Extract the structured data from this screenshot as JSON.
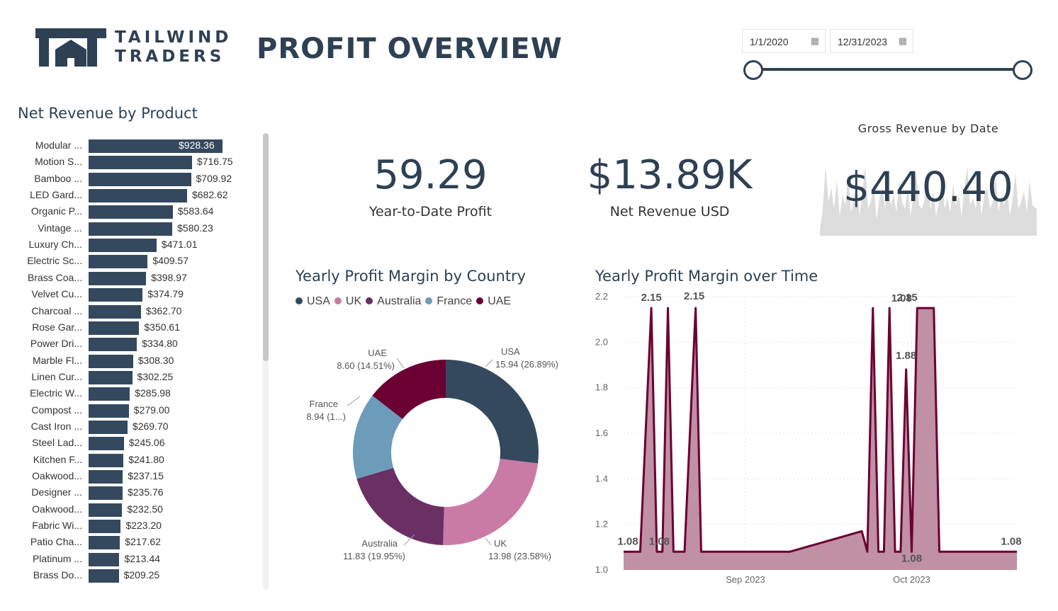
{
  "header": {
    "logo_line1": "TAILWIND",
    "logo_line2": "TRADERS",
    "title": "PROFIT OVERVIEW"
  },
  "date_range": {
    "start": "1/1/2020",
    "end": "12/31/2023",
    "calendar_icon": "calendar-icon"
  },
  "net_revenue_by_product": {
    "title": "Net Revenue by Product",
    "items": [
      {
        "label": "Modular ...",
        "value": "$928.36",
        "amount": 928.36
      },
      {
        "label": "Motion S...",
        "value": "$716.75",
        "amount": 716.75
      },
      {
        "label": "Bamboo ...",
        "value": "$709.92",
        "amount": 709.92
      },
      {
        "label": "LED Gard...",
        "value": "$682.62",
        "amount": 682.62
      },
      {
        "label": "Organic P...",
        "value": "$583.64",
        "amount": 583.64
      },
      {
        "label": "Vintage ...",
        "value": "$580.23",
        "amount": 580.23
      },
      {
        "label": "Luxury Ch...",
        "value": "$471.01",
        "amount": 471.01
      },
      {
        "label": "Electric Sc...",
        "value": "$409.57",
        "amount": 409.57
      },
      {
        "label": "Brass Coa...",
        "value": "$398.97",
        "amount": 398.97
      },
      {
        "label": "Velvet Cu...",
        "value": "$374.79",
        "amount": 374.79
      },
      {
        "label": "Charcoal ...",
        "value": "$362.70",
        "amount": 362.7
      },
      {
        "label": "Rose Gar...",
        "value": "$350.61",
        "amount": 350.61
      },
      {
        "label": "Power Dri...",
        "value": "$334.80",
        "amount": 334.8
      },
      {
        "label": "Marble Fl...",
        "value": "$308.30",
        "amount": 308.3
      },
      {
        "label": "Linen Cur...",
        "value": "$302.25",
        "amount": 302.25
      },
      {
        "label": "Electric W...",
        "value": "$285.98",
        "amount": 285.98
      },
      {
        "label": "Compost ...",
        "value": "$279.00",
        "amount": 279.0
      },
      {
        "label": "Cast Iron ...",
        "value": "$269.70",
        "amount": 269.7
      },
      {
        "label": "Steel Lad...",
        "value": "$245.06",
        "amount": 245.06
      },
      {
        "label": "Kitchen F...",
        "value": "$241.80",
        "amount": 241.8
      },
      {
        "label": "Oakwood...",
        "value": "$237.15",
        "amount": 237.15
      },
      {
        "label": "Designer ...",
        "value": "$235.76",
        "amount": 235.76
      },
      {
        "label": "Oakwood...",
        "value": "$232.50",
        "amount": 232.5
      },
      {
        "label": "Fabric Wi...",
        "value": "$223.20",
        "amount": 223.2
      },
      {
        "label": "Patio Cha...",
        "value": "$217.62",
        "amount": 217.62
      },
      {
        "label": "Platinum ...",
        "value": "$213.44",
        "amount": 213.44
      },
      {
        "label": "Brass Do...",
        "value": "$209.25",
        "amount": 209.25
      }
    ]
  },
  "kpis": {
    "ytd_profit": {
      "value": "59.29",
      "label": "Year-to-Date Profit"
    },
    "net_revenue": {
      "value": "$13.89K",
      "label": "Net Revenue USD"
    },
    "gross_revenue": {
      "title": "Gross Revenue by Date",
      "value": "$440.40"
    }
  },
  "profit_margin_by_country": {
    "title": "Yearly Profit Margin by Country",
    "legend": [
      {
        "name": "USA",
        "color": "#34495e"
      },
      {
        "name": "UK",
        "color": "#c97ba5"
      },
      {
        "name": "Australia",
        "color": "#6a2f63"
      },
      {
        "name": "France",
        "color": "#6d9bba"
      },
      {
        "name": "UAE",
        "color": "#6b0032"
      }
    ],
    "slices": [
      {
        "name": "USA",
        "value": 15.94,
        "pct": "26.89%",
        "label_name": "USA",
        "label_value": "15.94 (26.89%)"
      },
      {
        "name": "UK",
        "value": 13.98,
        "pct": "23.58%",
        "label_name": "UK",
        "label_value": "13.98 (23.58%)"
      },
      {
        "name": "Australia",
        "value": 11.83,
        "pct": "19.95%",
        "label_name": "Australia",
        "label_value": "11.83 (19.95%)"
      },
      {
        "name": "France",
        "value": 8.94,
        "pct": "15.07%",
        "label_name": "France",
        "label_value": "8.94 (1...)"
      },
      {
        "name": "UAE",
        "value": 8.6,
        "pct": "14.51%",
        "label_name": "UAE",
        "label_value": "8.60 (14.51%)"
      }
    ]
  },
  "profit_margin_over_time": {
    "title": "Yearly Profit Margin over Time",
    "color": "#6b0032",
    "fill": "#c090a5"
  },
  "chart_data": [
    {
      "type": "bar",
      "title": "Net Revenue by Product",
      "orientation": "horizontal",
      "categories": [
        "Modular ...",
        "Motion S...",
        "Bamboo ...",
        "LED Gard...",
        "Organic P...",
        "Vintage ...",
        "Luxury Ch...",
        "Electric Sc...",
        "Brass Coa...",
        "Velvet Cu...",
        "Charcoal ...",
        "Rose Gar...",
        "Power Dri...",
        "Marble Fl...",
        "Linen Cur...",
        "Electric W...",
        "Compost ...",
        "Cast Iron ...",
        "Steel Lad...",
        "Kitchen F...",
        "Oakwood...",
        "Designer ...",
        "Oakwood...",
        "Fabric Wi...",
        "Patio Cha...",
        "Platinum ...",
        "Brass Do..."
      ],
      "values": [
        928.36,
        716.75,
        709.92,
        682.62,
        583.64,
        580.23,
        471.01,
        409.57,
        398.97,
        374.79,
        362.7,
        350.61,
        334.8,
        308.3,
        302.25,
        285.98,
        279.0,
        269.7,
        245.06,
        241.8,
        237.15,
        235.76,
        232.5,
        223.2,
        217.62,
        213.44,
        209.25
      ]
    },
    {
      "type": "pie",
      "title": "Yearly Profit Margin by Country",
      "categories": [
        "USA",
        "UK",
        "Australia",
        "France",
        "UAE"
      ],
      "values": [
        15.94,
        13.98,
        11.83,
        8.94,
        8.6
      ],
      "donut": true
    },
    {
      "type": "area",
      "title": "Yearly Profit Margin over Time",
      "ylim": [
        1.0,
        2.2
      ],
      "yticks": [
        "2.2",
        "2.0",
        "1.8",
        "1.6",
        "1.4",
        "1.2",
        "1.0"
      ],
      "xticks": [
        "Sep 2023",
        "Oct 2023"
      ],
      "x": [
        "2023-08-10",
        "2023-08-13",
        "2023-08-15",
        "2023-08-16",
        "2023-08-17",
        "2023-08-18",
        "2023-08-19",
        "2023-08-21",
        "2023-08-23",
        "2023-08-24",
        "2023-08-25",
        "2023-09-09",
        "2023-09-22",
        "2023-09-23",
        "2023-09-24",
        "2023-09-25",
        "2023-09-26",
        "2023-09-27",
        "2023-09-28",
        "2023-09-29",
        "2023-09-30",
        "2023-10-01",
        "2023-10-02",
        "2023-10-03",
        "2023-10-05",
        "2023-10-06",
        "2023-10-20"
      ],
      "values": [
        1.08,
        1.08,
        2.15,
        1.08,
        1.08,
        2.15,
        1.08,
        1.08,
        2.15,
        1.08,
        1.08,
        1.08,
        1.17,
        1.08,
        2.15,
        1.08,
        1.08,
        2.15,
        1.08,
        1.08,
        1.88,
        1.08,
        2.15,
        2.15,
        2.15,
        1.08,
        1.08
      ],
      "data_labels": [
        {
          "x": "2023-08-10",
          "text": "1.08"
        },
        {
          "x": "2023-08-15",
          "text": "2.15"
        },
        {
          "x": "2023-08-19",
          "text": "1.08"
        },
        {
          "x": "2023-08-23",
          "text": "2.15"
        },
        {
          "x": "2023-09-30",
          "text": "1.88"
        },
        {
          "x": "2023-10-01",
          "text": "1.08"
        },
        {
          "x": "2023-10-02",
          "text": "1.08"
        },
        {
          "x": "2023-10-03",
          "text": "2.15"
        },
        {
          "x": "2023-10-20",
          "text": "1.08"
        }
      ]
    }
  ]
}
